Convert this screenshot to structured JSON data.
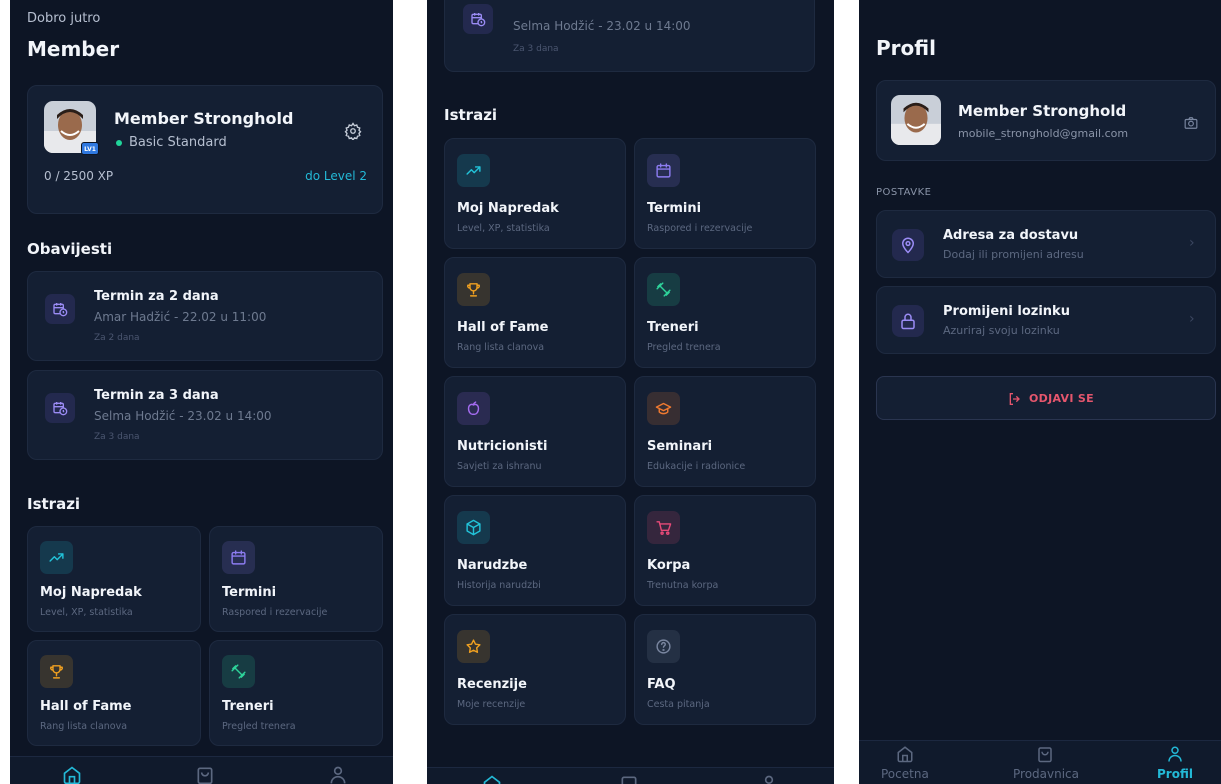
{
  "screen1": {
    "greeting": "Dobro jutro",
    "title": "Member",
    "profile": {
      "name": "Member Stronghold",
      "plan": "Basic Standard",
      "level_badge": "LV1",
      "xp": "0 / 2500 XP",
      "to_level": "do Level 2",
      "xp_progress": 0
    },
    "notifications_title": "Obavijesti",
    "notifications": [
      {
        "title": "Termin za 2 dana",
        "subtitle": "Amar Hadžić - 22.02 u 11:00",
        "meta": "Za 2 dana"
      },
      {
        "title": "Termin za 3 dana",
        "subtitle": "Selma Hodžić - 23.02 u 14:00",
        "meta": "Za 3 dana"
      }
    ],
    "explore_title": "Istrazi"
  },
  "screen2": {
    "notification_partial": {
      "subtitle": "Selma Hodžić - 23.02 u 14:00",
      "meta": "Za 3 dana"
    },
    "explore_title": "Istrazi"
  },
  "tiles": [
    {
      "title": "Moj Napredak",
      "subtitle": "Level, XP, statistika",
      "icon": "trend-up-icon",
      "color": "#22c3d9"
    },
    {
      "title": "Termini",
      "subtitle": "Raspored i rezervacije",
      "icon": "calendar-icon",
      "color": "#8c7cf0"
    },
    {
      "title": "Hall of Fame",
      "subtitle": "Rang lista clanova",
      "icon": "trophy-icon",
      "color": "#f0a020"
    },
    {
      "title": "Treneri",
      "subtitle": "Pregled trenera",
      "icon": "dumbbell-icon",
      "color": "#2ed39a"
    },
    {
      "title": "Nutricionisti",
      "subtitle": "Savjeti za ishranu",
      "icon": "apple-icon",
      "color": "#a46cf0"
    },
    {
      "title": "Seminari",
      "subtitle": "Edukacije i radionice",
      "icon": "graduation-cap-icon",
      "color": "#f07a30"
    },
    {
      "title": "Narudzbe",
      "subtitle": "Historija narudzbi",
      "icon": "package-icon",
      "color": "#22c3d9"
    },
    {
      "title": "Korpa",
      "subtitle": "Trenutna korpa",
      "icon": "cart-icon",
      "color": "#e84a78"
    },
    {
      "title": "Recenzije",
      "subtitle": "Moje recenzije",
      "icon": "star-icon",
      "color": "#f0a020"
    },
    {
      "title": "FAQ",
      "subtitle": "Cesta pitanja",
      "icon": "help-circle-icon",
      "color": "#7a86a0"
    }
  ],
  "screen3": {
    "title": "Profil",
    "profile": {
      "name": "Member Stronghold",
      "email": "mobile_stronghold@gmail.com"
    },
    "settings_label": "POSTAVKE",
    "settings": [
      {
        "title": "Adresa za dostavu",
        "subtitle": "Dodaj ili promijeni adresu",
        "icon": "map-pin-icon"
      },
      {
        "title": "Promijeni lozinku",
        "subtitle": "Azuriraj svoju lozinku",
        "icon": "lock-icon"
      }
    ],
    "logout_label": "ODJAVI SE"
  },
  "nav": {
    "items": [
      {
        "label": "Pocetna",
        "icon": "home-icon"
      },
      {
        "label": "Prodavnica",
        "icon": "shopping-bag-icon"
      },
      {
        "label": "Profil",
        "icon": "user-icon"
      }
    ],
    "active_color": "#23b9d7",
    "inactive_color": "#5c6880"
  },
  "colors": {
    "background": "#0d1525",
    "card": "#141f33",
    "accent": "#23b9d7",
    "danger": "#e5566d",
    "status_dot": "#20d49a"
  }
}
